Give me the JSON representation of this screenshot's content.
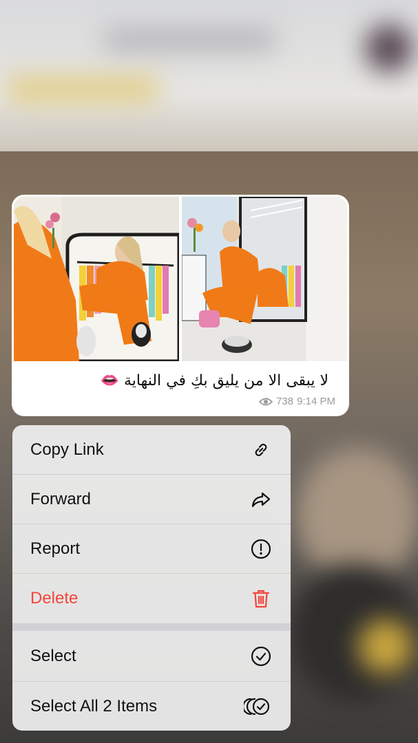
{
  "message": {
    "caption": "لا يبقى الا من يليق بكِ في النهاية 👄",
    "views": "738",
    "time": "9:14 PM"
  },
  "menu": {
    "items": [
      {
        "label": "Copy Link",
        "icon": "link-icon"
      },
      {
        "label": "Forward",
        "icon": "forward-arrow-icon"
      },
      {
        "label": "Report",
        "icon": "exclamation-circle-icon"
      },
      {
        "label": "Delete",
        "icon": "trash-icon",
        "color": "#f2463a"
      },
      {
        "label": "Select",
        "icon": "check-circle-icon"
      },
      {
        "label": "Select All 2 Items",
        "icon": "multi-check-circle-icon"
      }
    ]
  },
  "colors": {
    "danger": "#f2463a",
    "bubble": "#ffffff",
    "menu_bg": "#f0f0f0",
    "meta": "#9a9a9f",
    "outfit_orange": "#f07a18"
  }
}
